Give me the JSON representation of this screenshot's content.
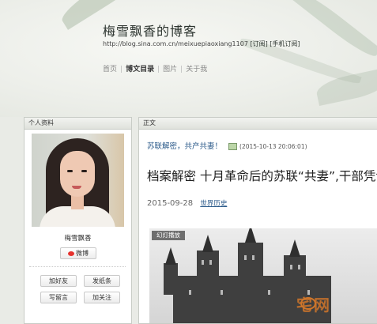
{
  "header": {
    "blog_title": "梅雪飘香的博客",
    "blog_url": "http://blog.sina.com.cn/meixuepiaoxiang1107",
    "subscribe": "[订阅]",
    "mobile_subscribe": "[手机订阅]",
    "nav": [
      "首页",
      "博文目录",
      "图片",
      "关于我"
    ]
  },
  "sidebar": {
    "panel_title": "个人资料",
    "username": "梅雪飘香",
    "weibo_label": "微博",
    "actions": [
      "加好友",
      "发纸条",
      "写留言",
      "加关注"
    ]
  },
  "main": {
    "panel_title": "正文",
    "category": "苏联解密，共产共妻！",
    "category_time": "(2015-10-13 20:06:01)",
    "post_title": "档案解密 十月革命后的苏联“共妻”,干部凭证",
    "post_date": "2015-09-28",
    "post_tag": "世界历史",
    "slideshow_label": "幻灯播放"
  },
  "watermark": "宅网"
}
